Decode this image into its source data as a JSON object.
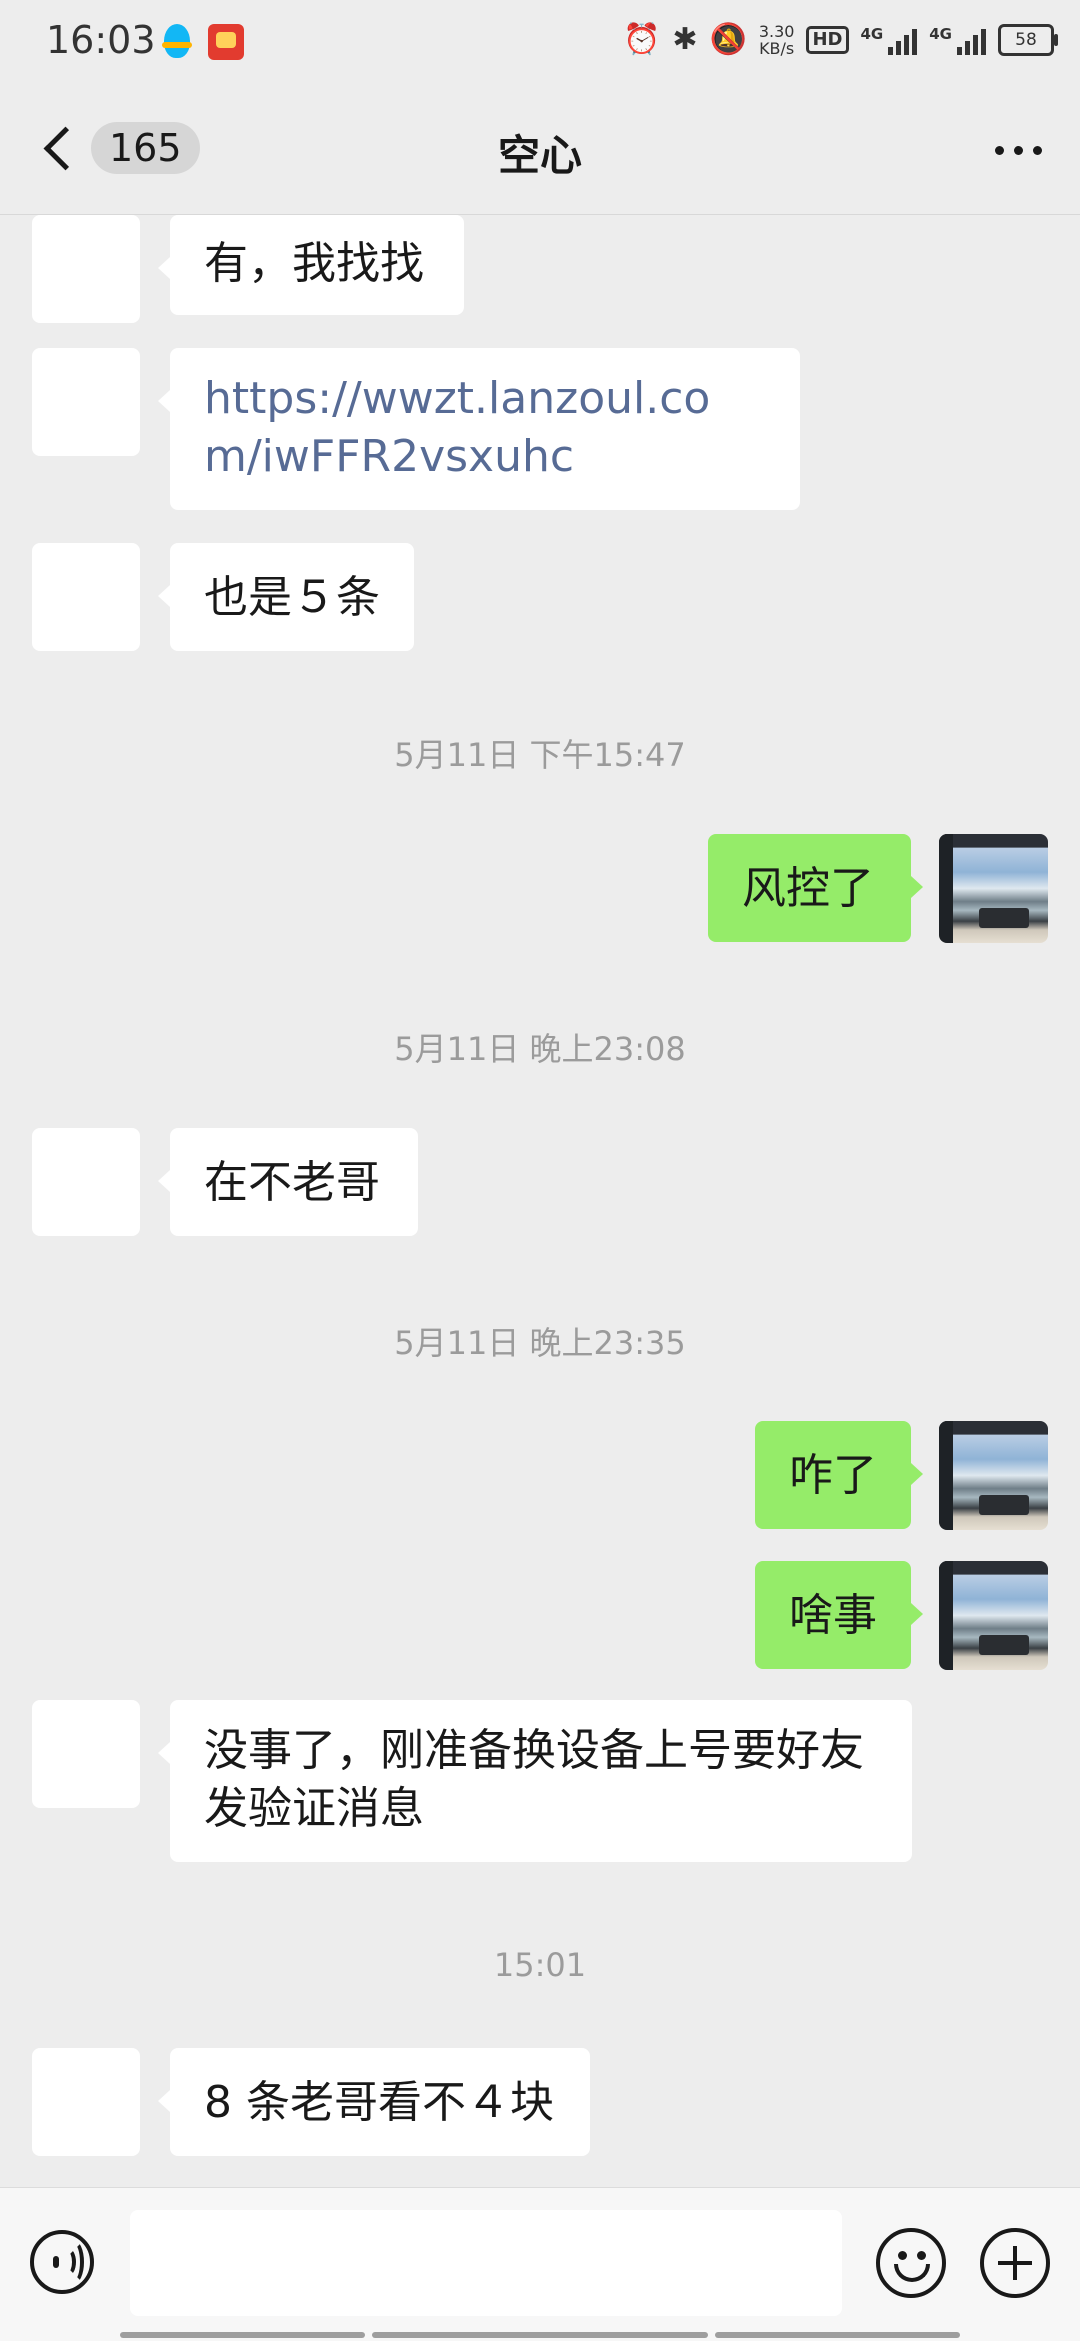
{
  "status_bar": {
    "time": "16:03",
    "net_speed_value": "3.30",
    "net_speed_unit": "KB/s",
    "hd": "HD",
    "sim1_label": "4G",
    "sim2_label": "4G",
    "battery": "58"
  },
  "header": {
    "unread_count": "165",
    "title": "空心"
  },
  "messages": [
    {
      "side": "in",
      "text": "有，我找找"
    },
    {
      "side": "in",
      "text": "https://wwzt.lanzoul.com/iwFFR2vsxuhc",
      "is_link": true
    },
    {
      "side": "in",
      "text": "也是５条"
    },
    {
      "type": "time",
      "text": "5月11日 下午15:47"
    },
    {
      "side": "out",
      "text": "风控了"
    },
    {
      "type": "time",
      "text": "5月11日 晚上23:08"
    },
    {
      "side": "in",
      "text": "在不老哥"
    },
    {
      "type": "time",
      "text": "5月11日 晚上23:35"
    },
    {
      "side": "out",
      "text": "咋了"
    },
    {
      "side": "out",
      "text": "啥事"
    },
    {
      "side": "in",
      "text": "没事了，刚准备换设备上号要好友发验证消息"
    },
    {
      "type": "time",
      "text": "15:01"
    },
    {
      "side": "in",
      "text": "8 条老哥看不４块"
    }
  ],
  "input": {
    "value": ""
  },
  "colors": {
    "background": "#ededed",
    "outgoing_bubble": "#95ec69",
    "incoming_bubble": "#ffffff",
    "link": "#576b95",
    "timestamp": "#9b9b9b"
  }
}
